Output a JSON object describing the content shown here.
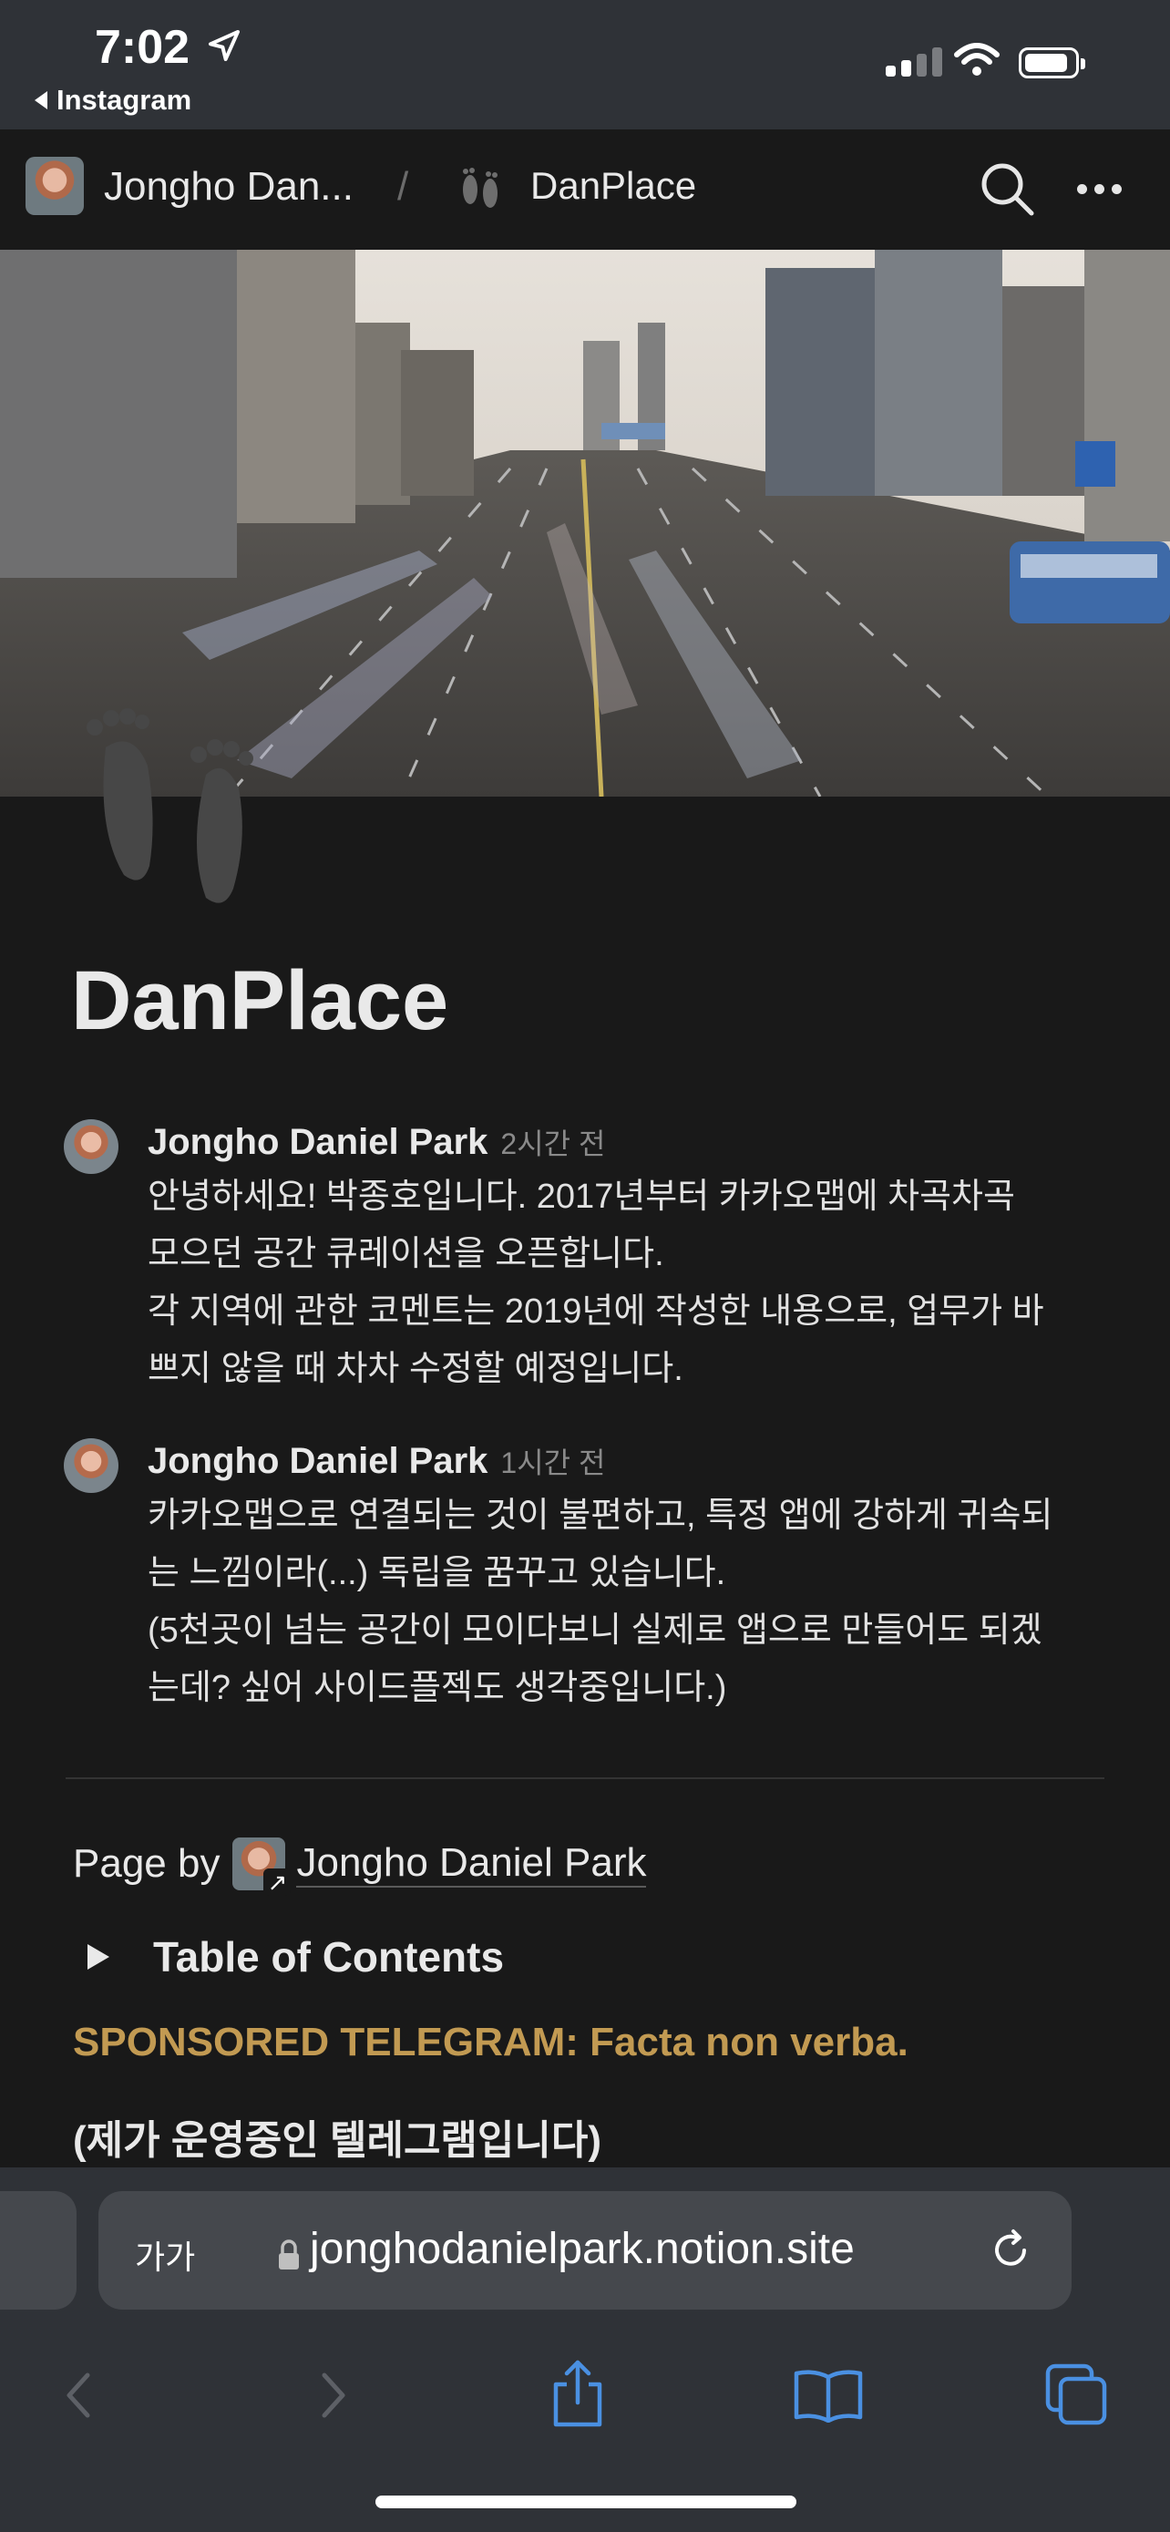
{
  "status_bar": {
    "time": "7:02",
    "back_app": "Instagram"
  },
  "topbar": {
    "breadcrumb_user": "Jongho Dan...",
    "separator": "/",
    "breadcrumb_page": "DanPlace"
  },
  "page": {
    "title": "DanPlace"
  },
  "comments": [
    {
      "author": "Jongho Daniel Park",
      "time_ago": "2시간 전",
      "lines": [
        "안녕하세요! 박종호입니다. 2017년부터 카카오맵에 차곡차곡",
        "모으던 공간 큐레이션을 오픈합니다.",
        "각 지역에 관한 코멘트는 2019년에 작성한 내용으로, 업무가 바",
        "쁘지 않을 때 차차 수정할 예정입니다."
      ]
    },
    {
      "author": "Jongho Daniel Park",
      "time_ago": "1시간 전",
      "lines": [
        "카카오맵으로 연결되는 것이 불편하고, 특정 앱에 강하게 귀속되",
        "는 느낌이라(...) 독립을 꿈꾸고 있습니다.",
        "(5천곳이 넘는 공간이 모이다보니 실제로 앱으로 만들어도 되겠",
        "는데? 싶어 사이드플젝도 생각중입니다.)"
      ]
    }
  ],
  "page_by": {
    "label": "Page by",
    "name": "Jongho Daniel Park"
  },
  "toc": {
    "label": "Table of Contents"
  },
  "sponsor": {
    "text": "SPONSORED TELEGRAM: Facta non verba."
  },
  "note": {
    "text": "(제가 운영중인 텔레그램입니다)"
  },
  "safari": {
    "text_size_label": "가가",
    "url": "jonghodanielpark.notion.site"
  },
  "colors": {
    "background": "#191919",
    "accent_gold": "#c29a52",
    "safari_blue": "#4a90e2"
  },
  "icons": [
    "location-arrow-icon",
    "signal-icon",
    "wifi-icon",
    "battery-icon",
    "footprints-icon",
    "search-icon",
    "more-icon",
    "lock-icon",
    "reload-icon",
    "back-icon",
    "forward-icon",
    "share-icon",
    "bookmarks-icon",
    "tabs-icon"
  ]
}
